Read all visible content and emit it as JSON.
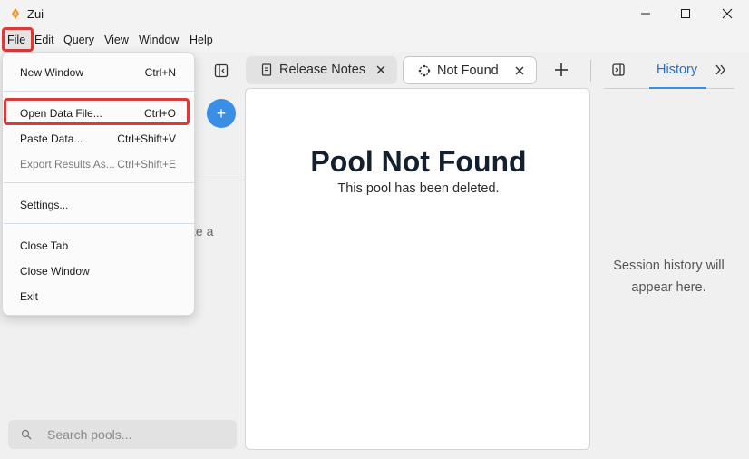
{
  "window": {
    "title": "Zui"
  },
  "menubar": {
    "items": [
      "File",
      "Edit",
      "Query",
      "View",
      "Window",
      "Help"
    ]
  },
  "file_menu": {
    "items": [
      {
        "label": "New Window",
        "shortcut": "Ctrl+N",
        "disabled": false
      },
      {
        "label": "Open Data File...",
        "shortcut": "Ctrl+O",
        "disabled": false
      },
      {
        "label": "Paste Data...",
        "shortcut": "Ctrl+Shift+V",
        "disabled": false
      },
      {
        "label": "Export Results As...",
        "shortcut": "Ctrl+Shift+E",
        "disabled": true
      },
      {
        "label": "Settings...",
        "shortcut": "",
        "disabled": false
      },
      {
        "label": "Close Tab",
        "shortcut": "",
        "disabled": false
      },
      {
        "label": "Close Window",
        "shortcut": "",
        "disabled": false
      },
      {
        "label": "Exit",
        "shortcut": "",
        "disabled": false
      }
    ]
  },
  "sidebar": {
    "partial_text": "te a",
    "search_placeholder": "Search pools..."
  },
  "tabs": [
    {
      "label": "Release Notes",
      "icon": "document-icon",
      "active": false
    },
    {
      "label": "Not Found",
      "icon": "pool-icon",
      "active": true
    }
  ],
  "main": {
    "title": "Pool Not Found",
    "subtitle": "This pool has been deleted."
  },
  "right_pane": {
    "tab_label": "History",
    "empty_text": "Session history will appear here."
  },
  "colors": {
    "accent": "#3b8ee6",
    "highlight": "#d63c3c",
    "title_text": "#15202e"
  }
}
